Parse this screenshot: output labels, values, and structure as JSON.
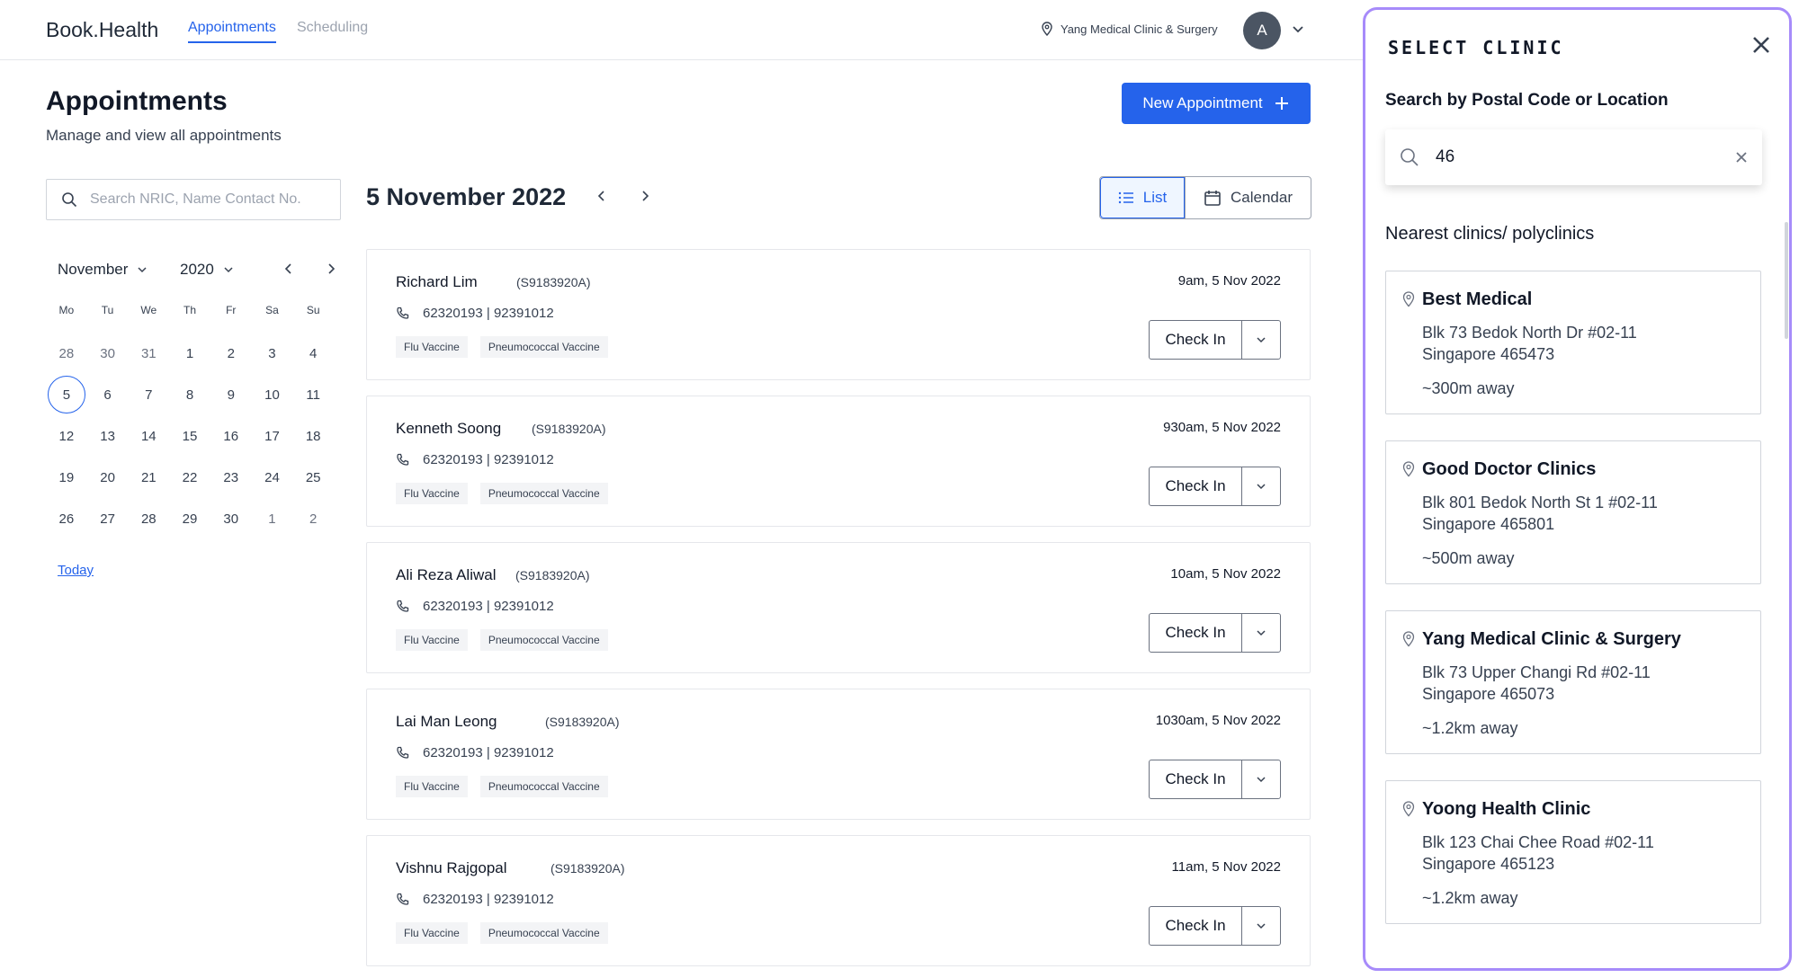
{
  "header": {
    "logo": "Book.Health",
    "tabs": [
      {
        "label": "Appointments",
        "active": true
      },
      {
        "label": "Scheduling",
        "active": false
      }
    ],
    "clinic": "Yang Medical Clinic & Surgery",
    "avatar_initial": "A"
  },
  "page": {
    "title": "Appointments",
    "subtitle": "Manage and view all appointments",
    "new_button": "New Appointment"
  },
  "search": {
    "placeholder": "Search NRIC, Name Contact No."
  },
  "calendar": {
    "month": "November",
    "year": "2020",
    "weekdays": [
      "Mo",
      "Tu",
      "We",
      "Th",
      "Fr",
      "Sa",
      "Su"
    ],
    "weeks": [
      [
        "28",
        "30",
        "31",
        "1",
        "2",
        "3",
        "4"
      ],
      [
        "5",
        "6",
        "7",
        "8",
        "9",
        "10",
        "11"
      ],
      [
        "12",
        "13",
        "14",
        "15",
        "16",
        "17",
        "18"
      ],
      [
        "19",
        "20",
        "21",
        "22",
        "23",
        "24",
        "25"
      ],
      [
        "26",
        "27",
        "28",
        "29",
        "30",
        "1",
        "2"
      ]
    ],
    "selected_day": "5",
    "today_label": "Today"
  },
  "date_header": {
    "title": "5 November 2022",
    "list_label": "List",
    "calendar_label": "Calendar"
  },
  "appointments": [
    {
      "name": "Richard Lim",
      "nric": "(S9183920A)",
      "phone": "62320193 | 92391012",
      "tags": [
        "Flu Vaccine",
        "Pneumococcal Vaccine"
      ],
      "time": "9am, 5 Nov 2022",
      "action": "Check In"
    },
    {
      "name": "Kenneth Soong",
      "nric": "(S9183920A)",
      "phone": "62320193 | 92391012",
      "tags": [
        "Flu Vaccine",
        "Pneumococcal Vaccine"
      ],
      "time": "930am, 5 Nov 2022",
      "action": "Check In"
    },
    {
      "name": "Ali Reza Aliwal",
      "nric": "(S9183920A)",
      "phone": "62320193 | 92391012",
      "tags": [
        "Flu Vaccine",
        "Pneumococcal Vaccine"
      ],
      "time": "10am, 5 Nov 2022",
      "action": "Check In"
    },
    {
      "name": "Lai Man Leong",
      "nric": "(S9183920A)",
      "phone": "62320193 | 92391012",
      "tags": [
        "Flu Vaccine",
        "Pneumococcal Vaccine"
      ],
      "time": "1030am, 5 Nov 2022",
      "action": "Check In"
    },
    {
      "name": "Vishnu Rajgopal",
      "nric": "(S9183920A)",
      "phone": "62320193 | 92391012",
      "tags": [
        "Flu Vaccine",
        "Pneumococcal Vaccine"
      ],
      "time": "11am, 5 Nov 2022",
      "action": "Check In"
    }
  ],
  "panel": {
    "title": "SELECT CLINIC",
    "search_label": "Search by Postal Code or Location",
    "search_value": "46",
    "nearest_label": "Nearest clinics/ polyclinics",
    "clinics": [
      {
        "name": "Best Medical",
        "address_line1": "Blk 73 Bedok North Dr #02-11",
        "address_line2": "Singapore 465473",
        "distance": "~300m away"
      },
      {
        "name": "Good Doctor Clinics",
        "address_line1": "Blk 801 Bedok North St 1 #02-11",
        "address_line2": "Singapore 465801",
        "distance": "~500m away"
      },
      {
        "name": "Yang Medical Clinic & Surgery",
        "address_line1": "Blk 73 Upper Changi Rd #02-11",
        "address_line2": "Singapore 465073",
        "distance": "~1.2km away"
      },
      {
        "name": "Yoong Health Clinic",
        "address_line1": "Blk 123 Chai Chee Road #02-11",
        "address_line2": "Singapore 465123",
        "distance": "~1.2km away"
      }
    ]
  },
  "colors": {
    "accent": "#2563eb",
    "panel_border": "#a78bfa"
  }
}
